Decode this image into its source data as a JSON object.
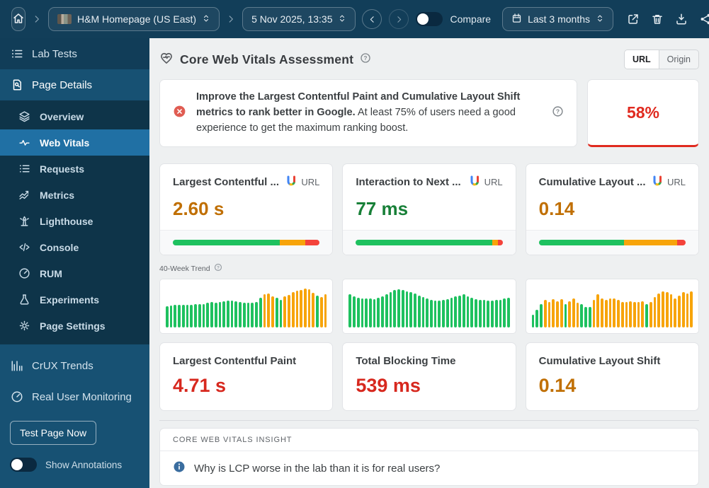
{
  "topbar": {
    "page_name": "H&M Homepage (US East)",
    "test_date": "5 Nov 2025, 13:35",
    "compare_label": "Compare",
    "date_range": "Last 3 months"
  },
  "sidebar": {
    "lab_tests_label": "Lab Tests",
    "page_details_label": "Page Details",
    "items": [
      {
        "label": "Overview"
      },
      {
        "label": "Web Vitals"
      },
      {
        "label": "Requests"
      },
      {
        "label": "Metrics"
      },
      {
        "label": "Lighthouse"
      },
      {
        "label": "Console"
      },
      {
        "label": "RUM"
      },
      {
        "label": "Experiments"
      },
      {
        "label": "Page Settings"
      }
    ],
    "crux_trends_label": "CrUX Trends",
    "rum_label": "Real User Monitoring",
    "test_button_label": "Test Page Now",
    "annotations_label": "Show Annotations"
  },
  "main": {
    "title": "Core Web Vitals Assessment",
    "view_toggle": {
      "url": "URL",
      "origin": "Origin"
    },
    "alert": {
      "bold_text": "Improve the Largest Contentful Paint and Cumulative Layout Shift metrics to rank better in Google.",
      "body_text": " At least 75% of users need a good experience to get the maximum ranking boost."
    },
    "score": {
      "value": "58%",
      "color": "#e02a1f"
    },
    "field_cards": [
      {
        "title": "Largest Contentful ...",
        "source_badge": "URL",
        "value": "2.60 s",
        "value_color": "#c06f03",
        "distribution": {
          "good": 73,
          "needs_improvement": 17,
          "poor": 10
        }
      },
      {
        "title": "Interaction to Next ...",
        "source_badge": "URL",
        "value": "77 ms",
        "value_color": "#188038",
        "distribution": {
          "good": 93,
          "needs_improvement": 4,
          "poor": 3
        }
      },
      {
        "title": "Cumulative Layout ...",
        "source_badge": "URL",
        "value": "0.14",
        "value_color": "#c06f03",
        "distribution": {
          "good": 58,
          "needs_improvement": 36,
          "poor": 6
        }
      }
    ],
    "trend_label": "40-Week Trend",
    "lab_cards": [
      {
        "title": "Largest Contentful Paint",
        "value": "4.71 s",
        "value_color": "#d7281e"
      },
      {
        "title": "Total Blocking Time",
        "value": "539 ms",
        "value_color": "#d7281e"
      },
      {
        "title": "Cumulative Layout Shift",
        "value": "0.14",
        "value_color": "#c06f03"
      }
    ],
    "insight": {
      "header": "CORE WEB VITALS INSIGHT",
      "question": "Why is LCP worse in the lab than it is for real users?"
    }
  },
  "colors": {
    "g": "#1ec15f",
    "o": "#f7a40a",
    "r": "#f4433b"
  },
  "chart_data": [
    {
      "type": "bar",
      "title": "Largest Contentful Paint 40-week trend",
      "ylim": [
        0,
        100
      ],
      "grid": false,
      "bars": [
        [
          50,
          "g"
        ],
        [
          52,
          "g"
        ],
        [
          53,
          "g"
        ],
        [
          54,
          "g"
        ],
        [
          53,
          "g"
        ],
        [
          53,
          "g"
        ],
        [
          54,
          "g"
        ],
        [
          55,
          "g"
        ],
        [
          55,
          "g"
        ],
        [
          56,
          "g"
        ],
        [
          58,
          "g"
        ],
        [
          60,
          "g"
        ],
        [
          58,
          "g"
        ],
        [
          60,
          "g"
        ],
        [
          62,
          "g"
        ],
        [
          63,
          "g"
        ],
        [
          63,
          "g"
        ],
        [
          62,
          "g"
        ],
        [
          60,
          "g"
        ],
        [
          58,
          "g"
        ],
        [
          58,
          "g"
        ],
        [
          59,
          "g"
        ],
        [
          60,
          "g"
        ],
        [
          70,
          "g"
        ],
        [
          78,
          "o"
        ],
        [
          80,
          "o"
        ],
        [
          73,
          "o"
        ],
        [
          70,
          "g"
        ],
        [
          66,
          "g"
        ],
        [
          74,
          "o"
        ],
        [
          77,
          "o"
        ],
        [
          84,
          "o"
        ],
        [
          87,
          "o"
        ],
        [
          88,
          "o"
        ],
        [
          92,
          "o"
        ],
        [
          90,
          "o"
        ],
        [
          82,
          "o"
        ],
        [
          76,
          "g"
        ],
        [
          72,
          "o"
        ],
        [
          78,
          "o"
        ]
      ]
    },
    {
      "type": "bar",
      "title": "Interaction to Next Paint 40-week trend",
      "ylim": [
        0,
        100
      ],
      "grid": false,
      "bars": [
        [
          78,
          "g"
        ],
        [
          74,
          "g"
        ],
        [
          71,
          "g"
        ],
        [
          69,
          "g"
        ],
        [
          68,
          "g"
        ],
        [
          68,
          "g"
        ],
        [
          67,
          "g"
        ],
        [
          70,
          "g"
        ],
        [
          74,
          "g"
        ],
        [
          79,
          "g"
        ],
        [
          84,
          "g"
        ],
        [
          89,
          "g"
        ],
        [
          91,
          "g"
        ],
        [
          88,
          "g"
        ],
        [
          85,
          "g"
        ],
        [
          83,
          "g"
        ],
        [
          80,
          "g"
        ],
        [
          76,
          "g"
        ],
        [
          72,
          "g"
        ],
        [
          68,
          "g"
        ],
        [
          66,
          "g"
        ],
        [
          64,
          "g"
        ],
        [
          63,
          "g"
        ],
        [
          65,
          "g"
        ],
        [
          67,
          "g"
        ],
        [
          70,
          "g"
        ],
        [
          73,
          "g"
        ],
        [
          76,
          "g"
        ],
        [
          78,
          "g"
        ],
        [
          74,
          "g"
        ],
        [
          70,
          "g"
        ],
        [
          67,
          "g"
        ],
        [
          66,
          "g"
        ],
        [
          65,
          "g"
        ],
        [
          64,
          "g"
        ],
        [
          64,
          "g"
        ],
        [
          65,
          "g"
        ],
        [
          66,
          "g"
        ],
        [
          68,
          "g"
        ],
        [
          70,
          "g"
        ]
      ]
    },
    {
      "type": "bar",
      "title": "Cumulative Layout Shift 40-week trend",
      "ylim": [
        0,
        100
      ],
      "grid": false,
      "bars": [
        [
          30,
          "g"
        ],
        [
          42,
          "g"
        ],
        [
          55,
          "g"
        ],
        [
          65,
          "o"
        ],
        [
          60,
          "o"
        ],
        [
          67,
          "o"
        ],
        [
          62,
          "o"
        ],
        [
          67,
          "o"
        ],
        [
          55,
          "g"
        ],
        [
          62,
          "o"
        ],
        [
          68,
          "o"
        ],
        [
          58,
          "o"
        ],
        [
          55,
          "g"
        ],
        [
          48,
          "g"
        ],
        [
          48,
          "g"
        ],
        [
          65,
          "o"
        ],
        [
          78,
          "o"
        ],
        [
          68,
          "o"
        ],
        [
          65,
          "o"
        ],
        [
          68,
          "o"
        ],
        [
          68,
          "o"
        ],
        [
          65,
          "o"
        ],
        [
          60,
          "o"
        ],
        [
          60,
          "o"
        ],
        [
          62,
          "o"
        ],
        [
          60,
          "o"
        ],
        [
          60,
          "o"
        ],
        [
          62,
          "o"
        ],
        [
          55,
          "g"
        ],
        [
          60,
          "o"
        ],
        [
          72,
          "o"
        ],
        [
          80,
          "o"
        ],
        [
          85,
          "o"
        ],
        [
          83,
          "o"
        ],
        [
          78,
          "o"
        ],
        [
          68,
          "o"
        ],
        [
          75,
          "o"
        ],
        [
          83,
          "o"
        ],
        [
          80,
          "o"
        ],
        [
          85,
          "o"
        ]
      ]
    }
  ]
}
